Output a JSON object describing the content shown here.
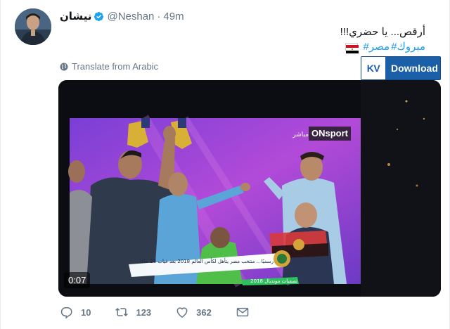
{
  "tweet": {
    "name": "نيشان",
    "handle": "@Neshan",
    "separator": "·",
    "time": "49m",
    "text": "أرقص... يا حضري!!!",
    "hashtags": [
      "#مبروك",
      "#مصر"
    ],
    "translate_label": "Translate from Arabic",
    "media": {
      "duration": "0:07",
      "overlay": {
        "channel_logo": "ONsport",
        "live_label": "مباشر",
        "ticker_text": "رسميًا .. منتخب مصر يتأهل لكأس العالم 2018 بعد غياب 28 عامًا",
        "ticker_sub": "تصفيات مونديال 2018"
      }
    },
    "actions": {
      "replies": "10",
      "retweets": "123",
      "likes": "362"
    }
  },
  "extension": {
    "logo": "KV",
    "label": "Download"
  },
  "colors": {
    "link_blue": "#1da1f2",
    "muted_gray": "#657786",
    "kv_blue": "#1b5fa8"
  },
  "icons": [
    "verified-badge-icon",
    "globe-icon",
    "reply-icon",
    "retweet-icon",
    "like-icon",
    "direct-message-icon"
  ]
}
